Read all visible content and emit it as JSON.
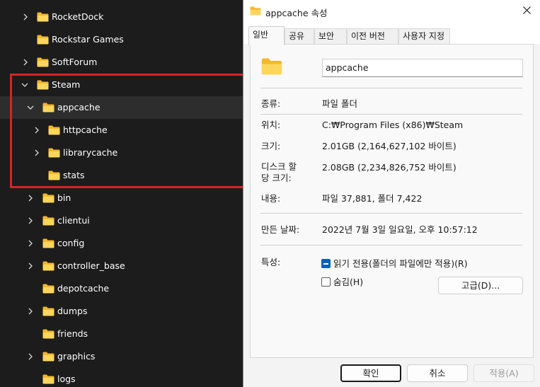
{
  "tree": {
    "items": [
      {
        "label": "RocketDock",
        "chevron": "right"
      },
      {
        "label": "Rockstar Games",
        "chevron": "none"
      },
      {
        "label": "SoftForum",
        "chevron": "right"
      },
      {
        "label": "Steam",
        "chevron": "down"
      },
      {
        "label": "appcache",
        "chevron": "down"
      },
      {
        "label": "httpcache",
        "chevron": "right"
      },
      {
        "label": "librarycache",
        "chevron": "right"
      },
      {
        "label": "stats",
        "chevron": "none"
      },
      {
        "label": "bin",
        "chevron": "right"
      },
      {
        "label": "clientui",
        "chevron": "right"
      },
      {
        "label": "config",
        "chevron": "right"
      },
      {
        "label": "controller_base",
        "chevron": "right"
      },
      {
        "label": "depotcache",
        "chevron": "none"
      },
      {
        "label": "dumps",
        "chevron": "right"
      },
      {
        "label": "friends",
        "chevron": "none"
      },
      {
        "label": "graphics",
        "chevron": "right"
      },
      {
        "label": "logs",
        "chevron": "none"
      }
    ],
    "selected": "appcache",
    "highlight_color": "#d32525"
  },
  "dialog": {
    "title": "appcache 속성",
    "tabs": [
      "일반",
      "공유",
      "보안",
      "이전 버전",
      "사용자 지정"
    ],
    "active_tab": "일반",
    "folder_name": "appcache",
    "fields": {
      "type_label": "종류:",
      "type_value": "파일 폴더",
      "location_label": "위치:",
      "location_value": "C:₩Program Files (x86)₩Steam",
      "size_label": "크기:",
      "size_value": "2.01GB (2,164,627,102 바이트)",
      "disk_size_label_line1": "디스크 할",
      "disk_size_label_line2": "당 크기:",
      "disk_size_value": "2.08GB (2,234,826,752 바이트)",
      "contains_label": "내용:",
      "contains_value": "파일 37,881, 폴더 7,422",
      "created_label": "만든 날짜:",
      "created_value": "2022년 7월 3일 일요일, 오후 10:57:12",
      "attributes_label": "특성:"
    },
    "attributes": {
      "readonly_label": "읽기 전용(폴더의 파일에만 적용)(R)",
      "readonly_state": "indeterminate",
      "hidden_label": "숨김(H)",
      "hidden_state": "unchecked"
    },
    "buttons": {
      "advanced": "고급(D)...",
      "ok": "확인",
      "cancel": "취소",
      "apply": "적용(A)"
    },
    "accent_color": "#005fb8",
    "folder_color": "#ffc83d"
  }
}
